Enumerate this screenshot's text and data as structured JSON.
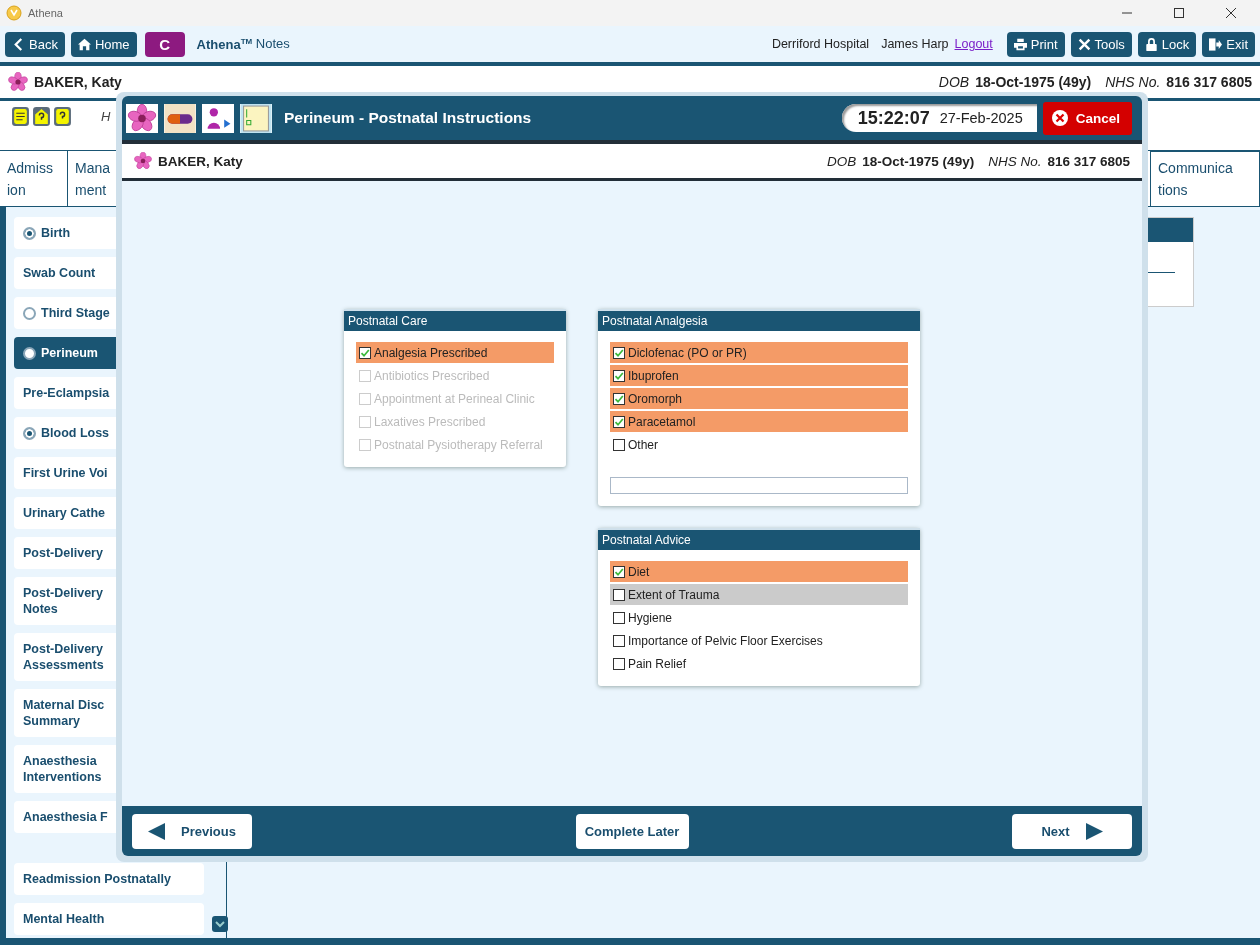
{
  "window": {
    "title": "Athena"
  },
  "toolbar": {
    "buttons": [
      {
        "label": "Back",
        "kind": "back"
      },
      {
        "label": "Home",
        "kind": "home"
      }
    ],
    "badge": "C",
    "app_name": "Athena",
    "app_mark": "TM",
    "app_suffix": "Notes",
    "location": "Derriford Hospital",
    "user": "James Harp",
    "logout": "Logout",
    "actions": [
      {
        "label": "Print",
        "kind": "print"
      },
      {
        "label": "Tools",
        "kind": "tools"
      },
      {
        "label": "Lock",
        "kind": "lock"
      },
      {
        "label": "Exit",
        "kind": "exit"
      }
    ]
  },
  "patient": {
    "name": "BAKER, Katy",
    "dob_label": "DOB",
    "dob": "18-Oct-1975 (49y)",
    "nhs_label": "NHS No.",
    "nhs": "816 317 6805"
  },
  "alerts_text": "H",
  "tabs": [
    {
      "lines": [
        "Admiss",
        "ion"
      ],
      "selected": false
    },
    {
      "lines": [
        "Mana",
        "ment"
      ],
      "selected": false
    },
    {
      "lines": [
        "Communica",
        "tions"
      ],
      "selected": false
    }
  ],
  "sidebar": {
    "items": [
      {
        "label": "Birth",
        "done": true,
        "selected": false
      },
      {
        "label": "Swab Count",
        "selected": false
      },
      {
        "label": "Third Stage",
        "done": false,
        "selected": false
      },
      {
        "label": "Perineum",
        "done": false,
        "selected": true
      },
      {
        "label": "Pre-Eclampsia",
        "selected": false
      },
      {
        "label": "Blood Loss",
        "done": true,
        "selected": false
      },
      {
        "label": "First Urine Voi",
        "selected": false
      },
      {
        "label": "Urinary Cathe",
        "selected": false
      },
      {
        "label": "Post-Delivery",
        "selected": false
      },
      {
        "label": "Post-Delivery Notes",
        "selected": false
      },
      {
        "label": "Post-Delivery Assessments",
        "selected": false
      },
      {
        "label": "Maternal Disc Summary",
        "selected": false
      },
      {
        "label": "Anaesthesia Interventions",
        "selected": false
      },
      {
        "label": "Anaesthesia F",
        "selected": false
      }
    ],
    "more_items": [
      {
        "label": "Readmission Postnatally",
        "selected": false
      },
      {
        "label": "Mental Health",
        "selected": false
      }
    ]
  },
  "dialog": {
    "title": "Perineum - Postnatal Instructions",
    "time": "15:22:07",
    "date": "27-Feb-2025",
    "cancel": "Cancel",
    "patient": {
      "name": "BAKER, Katy",
      "dob_label": "DOB",
      "dob": "18-Oct-1975 (49y)",
      "nhs_label": "NHS No.",
      "nhs": "816 317 6805"
    },
    "panels": [
      {
        "title": "Postnatal Care",
        "items": [
          {
            "label": "Analgesia Prescribed",
            "checked": true,
            "disabled": false,
            "focused": false
          },
          {
            "label": "Antibiotics Prescribed",
            "checked": false,
            "disabled": true,
            "focused": false
          },
          {
            "label": "Appointment at Perineal Clinic",
            "checked": false,
            "disabled": true,
            "focused": false
          },
          {
            "label": "Laxatives Prescribed",
            "checked": false,
            "disabled": true,
            "focused": false
          },
          {
            "label": "Postnatal Pysiotherapy Referral",
            "checked": false,
            "disabled": true,
            "focused": false
          }
        ]
      },
      {
        "title": "Postnatal Analgesia",
        "has_field": true,
        "items": [
          {
            "label": "Diclofenac (PO or PR)",
            "checked": true,
            "disabled": false,
            "focused": false
          },
          {
            "label": "Ibuprofen",
            "checked": true,
            "disabled": false,
            "focused": false
          },
          {
            "label": "Oromorph",
            "checked": true,
            "disabled": false,
            "focused": false
          },
          {
            "label": "Paracetamol",
            "checked": true,
            "disabled": false,
            "focused": false
          },
          {
            "label": "Other",
            "checked": false,
            "disabled": false,
            "focused": false
          }
        ]
      },
      {
        "title": "Postnatal Advice",
        "items": [
          {
            "label": "Diet",
            "checked": true,
            "disabled": false,
            "focused": false
          },
          {
            "label": "Extent of Trauma",
            "checked": false,
            "disabled": false,
            "focused": true
          },
          {
            "label": "Hygiene",
            "checked": false,
            "disabled": false,
            "focused": false
          },
          {
            "label": "Importance of Pelvic Floor Exercises",
            "checked": false,
            "disabled": false,
            "focused": false
          },
          {
            "label": "Pain Relief",
            "checked": false,
            "disabled": false,
            "focused": false
          }
        ]
      }
    ],
    "footer": {
      "previous": "Previous",
      "later": "Complete Later",
      "next": "Next"
    }
  }
}
